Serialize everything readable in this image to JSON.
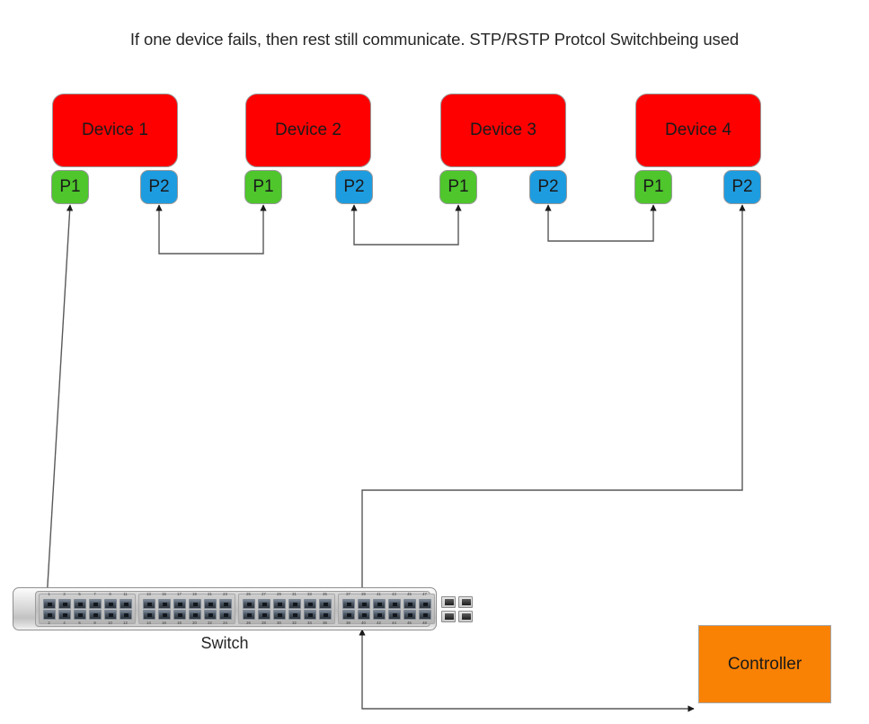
{
  "title": "If one device fails, then rest still communicate. STP/RSTP Protcol Switchbeing used",
  "colors": {
    "device_fill": "#ff0000",
    "port_p1_fill": "#4ec62c",
    "port_p2_fill": "#1e9ce0",
    "controller_fill": "#f98103",
    "connector_stroke": "#595959",
    "arrowhead": "#1a1a1a",
    "text": "#1a1a1a"
  },
  "devices": [
    {
      "label": "Device 1",
      "p1": "P1",
      "p2": "P2"
    },
    {
      "label": "Device 2",
      "p1": "P1",
      "p2": "P2"
    },
    {
      "label": "Device 3",
      "p1": "P1",
      "p2": "P2"
    },
    {
      "label": "Device 4",
      "p1": "P1",
      "p2": "P2"
    }
  ],
  "switch": {
    "label": "Switch",
    "top_port_numbers": [
      1,
      3,
      5,
      7,
      9,
      11,
      13,
      15,
      17,
      19,
      21,
      23,
      25,
      27,
      29,
      31,
      33,
      35,
      37,
      39,
      41,
      43,
      45,
      47
    ],
    "bottom_port_numbers": [
      2,
      4,
      6,
      8,
      10,
      12,
      14,
      16,
      18,
      20,
      22,
      24,
      26,
      28,
      30,
      32,
      34,
      36,
      38,
      40,
      42,
      44,
      46,
      48
    ],
    "port_group_count": 4,
    "ports_per_group": 6,
    "sfp_port_count": 4
  },
  "controller": {
    "label": "Controller"
  },
  "connections": [
    {
      "from": "device-1-p2",
      "to": "device-2-p1",
      "style": "double-arrow-elbow"
    },
    {
      "from": "device-2-p2",
      "to": "device-3-p1",
      "style": "double-arrow-elbow"
    },
    {
      "from": "device-3-p2",
      "to": "device-4-p1",
      "style": "double-arrow-elbow"
    },
    {
      "from": "device-1-p1",
      "to": "switch-port-1",
      "style": "double-arrow-diagonal"
    },
    {
      "from": "device-4-p2",
      "to": "switch-port-45",
      "style": "double-arrow-elbow"
    },
    {
      "from": "switch-port-48",
      "to": "controller",
      "style": "double-arrow-elbow"
    }
  ]
}
